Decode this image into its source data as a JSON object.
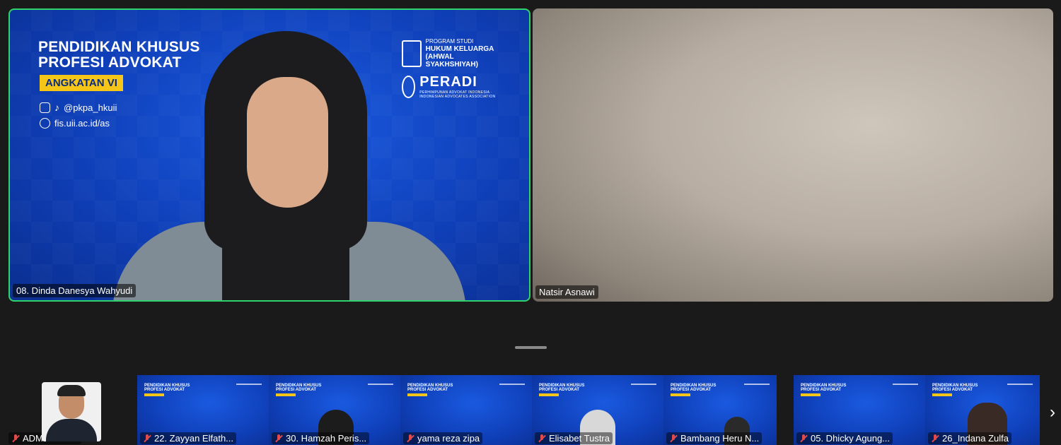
{
  "main_tiles": [
    {
      "name": "08. Dinda Danesya Wahyudi",
      "background": {
        "title_line1": "PENDIDIKAN KHUSUS",
        "title_line2": "PROFESI ADVOKAT",
        "badge": "ANGKATAN VI",
        "instagram": "@pkpa_hkuii",
        "website": "fis.uii.ac.id/as",
        "program_label": "PROGRAM STUDI",
        "program_name1": "HUKUM KELUARGA",
        "program_name2": "(AHWAL SYAKHSHIYAH)",
        "org_name": "PERADI",
        "org_sub": "PERHIMPUNAN ADVOKAT INDONESIA · INDONESIAN ADVOCATES ASSOCIATION"
      },
      "active_speaker": true
    },
    {
      "name": "Natsir Asnawi",
      "active_speaker": false
    }
  ],
  "thumbnails": [
    {
      "name": "ADMIN PKPA",
      "muted": true
    },
    {
      "name": "22. Zayyan Elfath...",
      "muted": true
    },
    {
      "name": "30. Hamzah Peris...",
      "muted": true
    },
    {
      "name": "yama reza zipa",
      "muted": true
    },
    {
      "name": "Elisabet Tustra",
      "muted": true
    },
    {
      "name": "Bambang Heru N...",
      "muted": true
    },
    {
      "name": "05. Dhicky Agung...",
      "muted": true
    },
    {
      "name": "26_Indana Zulfa",
      "muted": true
    }
  ],
  "colors": {
    "active_border": "#2fd36b",
    "muted_icon": "#e34b4b",
    "badge": "#f5c518",
    "bg": "#1a1a1a"
  },
  "icons": {
    "next": "›"
  }
}
